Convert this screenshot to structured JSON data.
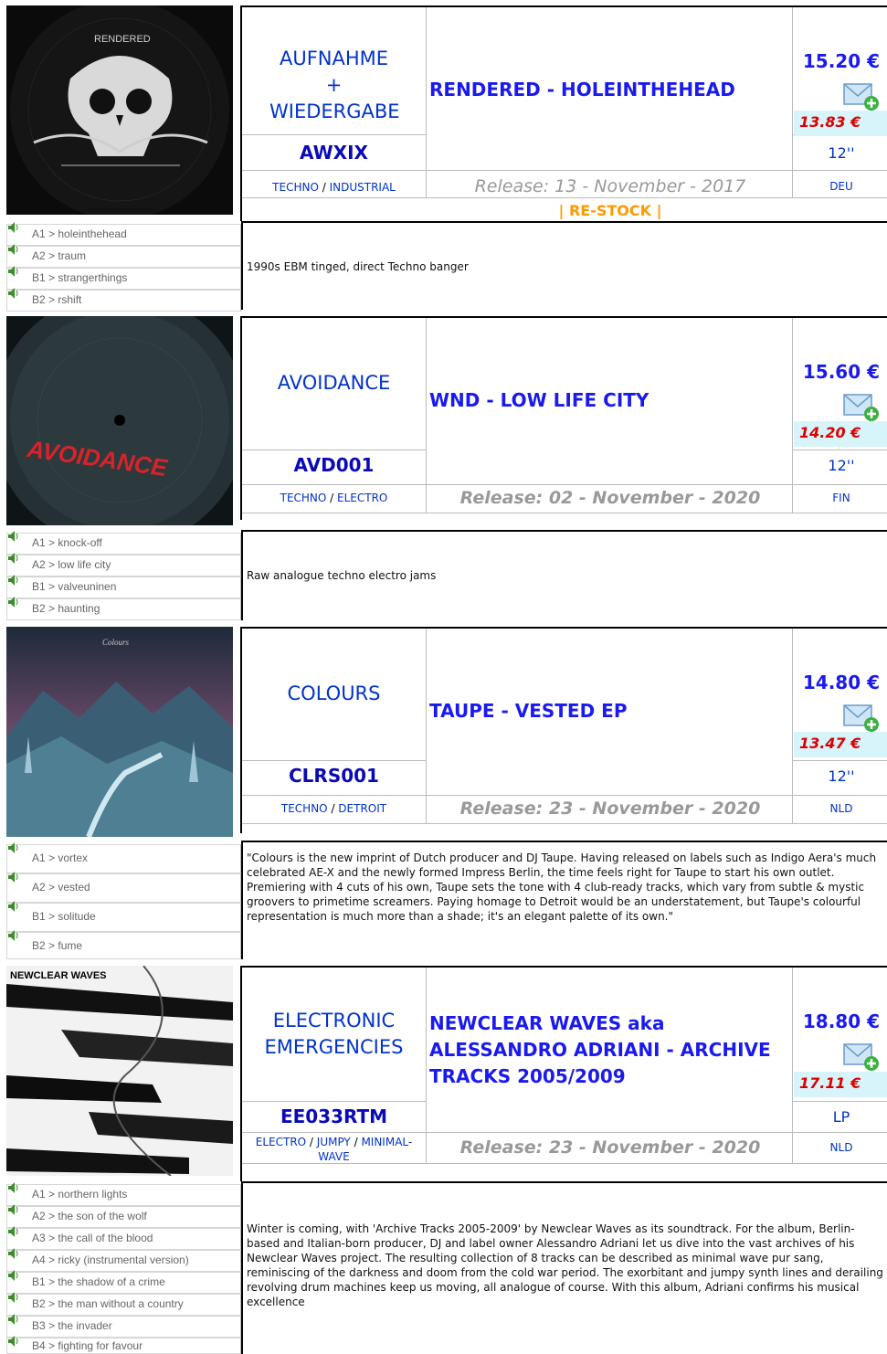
{
  "ui": {
    "currency": "€",
    "accent_color": "#1a1aee",
    "discount_color": "#dd0000",
    "restock_color": "#ff9900",
    "mail_icon": "email-add-icon",
    "speaker_icon": "speaker-icon"
  },
  "releases": [
    {
      "label": "AUFNAHME + WIEDERGABE",
      "title": "RENDERED - HOLEINTHEHEAD",
      "catno": "AWXIX",
      "genre_a": "TECHNO",
      "genre_sep": " / ",
      "genre_b": "INDUSTRIAL",
      "genre_c": "",
      "release": "Release: 13 - November - 2017",
      "price": "15.20 €",
      "discount_price": "13.83 €",
      "format": "12''",
      "country": "DEU",
      "note": "| RE-STOCK |",
      "cover_text": "RENDERED",
      "description": "1990s EBM tinged, direct Techno banger",
      "tracks": [
        "A1 > holeinthehead",
        "A2 > traum",
        "B1 > strangerthings",
        "B2 > rshift"
      ]
    },
    {
      "label": "AVOIDANCE",
      "title": "WND - LOW LIFE CITY",
      "catno": "AVD001",
      "genre_a": "TECHNO",
      "genre_sep": " / ",
      "genre_b": "ELECTRO",
      "genre_c": "",
      "release": "Release: 02 - November - 2020",
      "price": "15.60 €",
      "discount_price": "14.20 €",
      "format": "12''",
      "country": "FIN",
      "cover_text": "AVOIDANCE",
      "description": "Raw analogue techno electro jams",
      "tracks": [
        "A1 > knock-off",
        "A2 > low life city",
        "B1 > valveuninen",
        "B2 > haunting"
      ]
    },
    {
      "label": "COLOURS",
      "title": "TAUPE - VESTED EP",
      "catno": "CLRS001",
      "genre_a": "TECHNO",
      "genre_sep": " / ",
      "genre_b": "DETROIT",
      "genre_c": "",
      "release": "Release: 23 - November - 2020",
      "price": "14.80 €",
      "discount_price": "13.47 €",
      "format": "12''",
      "country": "NLD",
      "cover_text": "Colours",
      "description": "\"Colours is the new imprint of Dutch producer and DJ Taupe. Having released on labels such as Indigo Aera's much celebrated AE-X and the newly formed Impress Berlin, the time feels right for Taupe to start his own outlet. Premiering with 4 cuts of his own, Taupe sets the tone with 4 club-ready tracks, which vary from subtle & mystic groovers to primetime screamers. Paying homage to Detroit would be an understatement, but Taupe's colourful representation is much more than a shade; it's an elegant palette of its own.\"",
      "tracks": [
        "A1 > vortex",
        "A2 > vested",
        "B1 > solitude",
        "B2 > fume"
      ]
    },
    {
      "label": "ELECTRONIC EMERGENCIES",
      "title": "NEWCLEAR WAVES aka ALESSANDRO ADRIANI - ARCHIVE TRACKS 2005/2009",
      "catno": "EE033RTM",
      "genre_a": "ELECTRO",
      "genre_sep": " / ",
      "genre_b": "JUMPY",
      "genre_c": "MINIMAL-WAVE",
      "release": "Release: 23 - November - 2020",
      "price": "18.80 €",
      "discount_price": "17.11 €",
      "format": "LP",
      "country": "NLD",
      "cover_text": "NEWCLEAR WAVES",
      "description": "Winter is coming, with 'Archive Tracks 2005-2009' by Newclear Waves as its soundtrack. For the album, Berlin-based and Italian-born producer, DJ and label owner Alessandro Adriani let us dive into the vast archives of his Newclear Waves project. The resulting collection of 8 tracks can be described as minimal wave pur sang, reminiscing of the darkness and doom from the cold war period. The exorbitant and jumpy synth lines and derailing revolving drum machines keep us moving, all analogue of course. With this album, Adriani confirms his musical excellence",
      "tracks": [
        "A1 > northern lights",
        "A2 > the son of the wolf",
        "A3 > the call of the blood",
        "A4 > ricky (instrumental version)",
        "B1 > the shadow of a crime",
        "B2 > the man without a country",
        "B3 > the invader",
        "B4 > fighting for favour"
      ]
    }
  ]
}
